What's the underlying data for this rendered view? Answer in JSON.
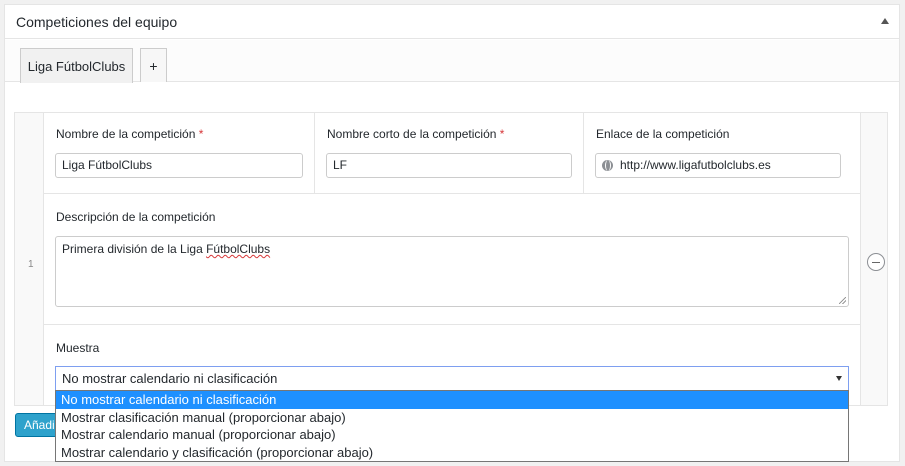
{
  "panel": {
    "title": "Competiciones del equipo"
  },
  "tabs": [
    {
      "label": "Liga FútbolClubs"
    },
    {
      "label": "+"
    }
  ],
  "row": {
    "index": "1",
    "name": {
      "label": "Nombre de la competición",
      "required": "*",
      "value": "Liga FútbolClubs"
    },
    "short_name": {
      "label": "Nombre corto de la competición",
      "required": "*",
      "value": "LF"
    },
    "link": {
      "label": "Enlace de la competición",
      "value": "http://www.ligafutbolclubs.es"
    },
    "description": {
      "label": "Descripción de la competición",
      "value_prefix": "Primera división de la Liga ",
      "value_misspelled": "FútbolClubs"
    },
    "muestra": {
      "label": "Muestra",
      "selected": "No mostrar calendario ni clasificación",
      "options": [
        "No mostrar calendario ni clasificación",
        "Mostrar clasificación manual (proporcionar abajo)",
        "Mostrar calendario manual (proporcionar abajo)",
        "Mostrar calendario y clasificación (proporcionar abajo)"
      ]
    }
  },
  "add_button": {
    "label": "Añadir"
  },
  "colors": {
    "accent": "#2ea2cc",
    "required": "#d63638",
    "highlight": "#1e90ff"
  },
  "icons": [
    "collapse-arrow-icon",
    "globe-icon",
    "remove-row-icon",
    "select-arrow-icon",
    "resize-grip-icon"
  ]
}
